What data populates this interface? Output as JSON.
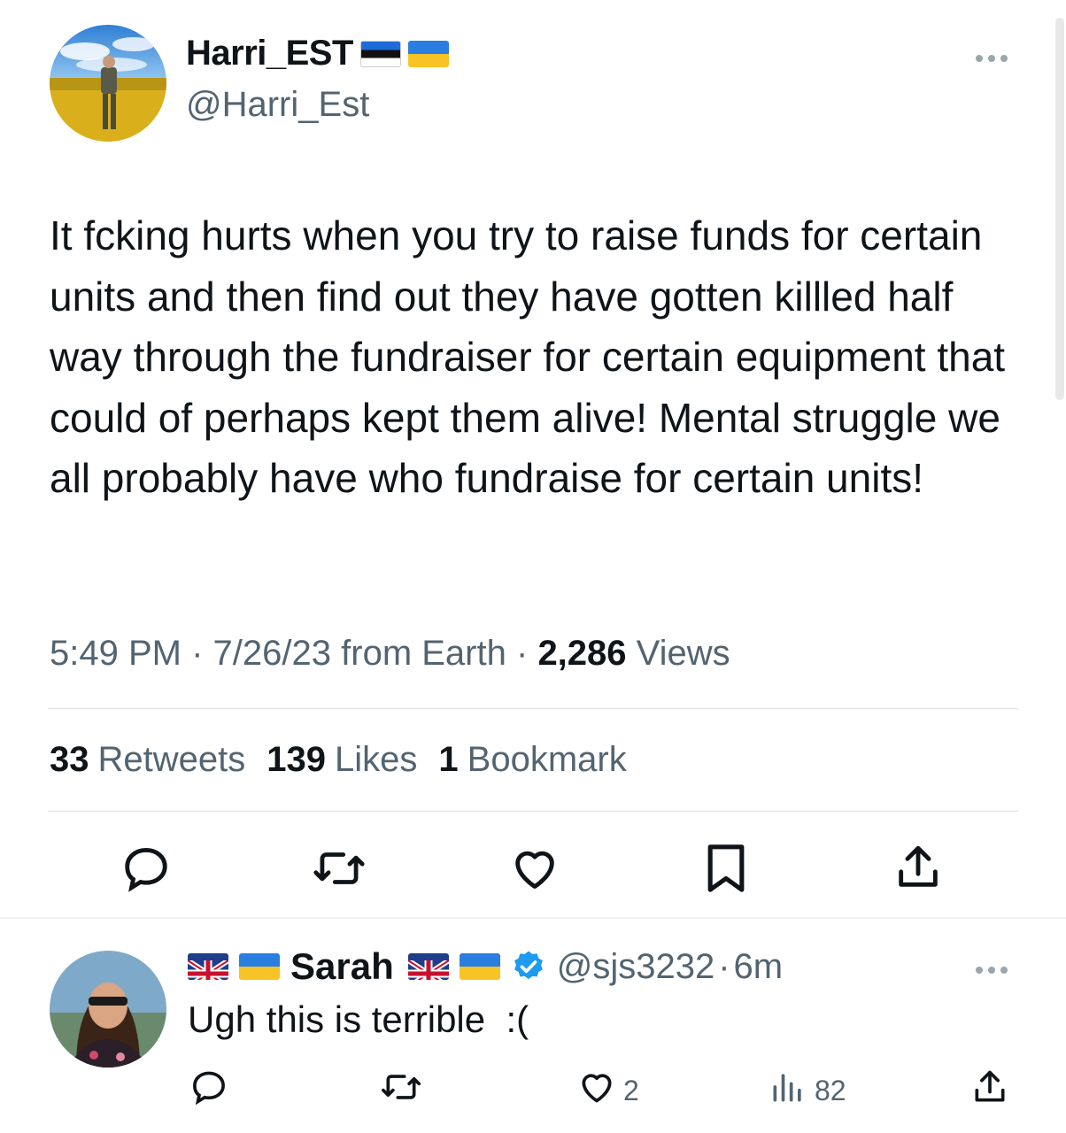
{
  "main_tweet": {
    "display_name": "Harri_EST",
    "handle": "@Harri_Est",
    "flags": [
      "estonia-flag",
      "ukraine-flag"
    ],
    "more_icon": "more-icon",
    "text": "It fcking hurts when you try to raise funds for certain units and then find out they have gotten killled half way through the fundraiser for certain equipment that could of perhaps kept them alive! Mental struggle we all probably have who fundraise for certain units!",
    "time": "5:49 PM",
    "date": "7/26/23",
    "source": "from Earth",
    "separator": "·",
    "views_count": "2,286",
    "views_label": "Views",
    "stats": {
      "retweets_count": "33",
      "retweets_label": "Retweets",
      "likes_count": "139",
      "likes_label": "Likes",
      "bookmarks_count": "1",
      "bookmarks_label": "Bookmark"
    },
    "actions": [
      "reply-icon",
      "retweet-icon",
      "like-icon",
      "bookmark-icon",
      "share-icon"
    ]
  },
  "reply": {
    "display_name": "Sarah",
    "handle": "@sjs3232",
    "separator": "·",
    "time": "6m",
    "flags_before": [
      "uk-flag",
      "ukraine-flag"
    ],
    "flags_after": [
      "uk-flag",
      "ukraine-flag"
    ],
    "verified_icon": "verified-badge-icon",
    "text": "Ugh this is terrible  :(",
    "likes": "2",
    "views": "82",
    "actions": [
      "reply-icon",
      "retweet-icon",
      "like-icon",
      "views-icon",
      "share-icon"
    ]
  },
  "colors": {
    "primary_text": "#0f1419",
    "secondary_text": "#536471",
    "divider": "#e1e5e8",
    "verified_blue": "#1d9bf0"
  }
}
